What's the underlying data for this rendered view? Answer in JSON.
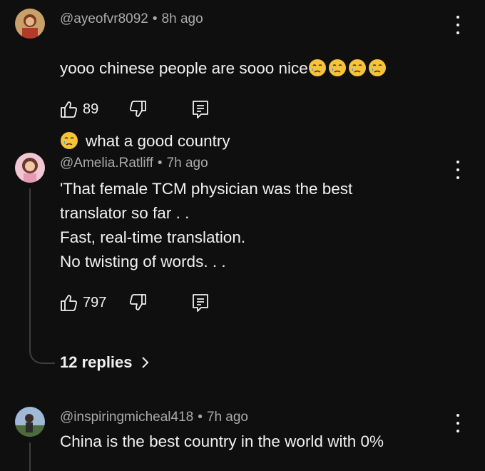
{
  "colors": {
    "background": "#0f0f0f",
    "text": "#f1f1f1",
    "meta": "#aaaaaa",
    "thread_line": "#3f3f3f",
    "emoji": "#f7c33a"
  },
  "comments": [
    {
      "author": "@ayeofvr8092",
      "time": "8h ago",
      "text_line1": "yooo chinese people are sooo nice",
      "text_line2": "what a good country",
      "emoji": "crying-face-with-tear",
      "likes": "89",
      "icons": [
        "thumbs-up-icon",
        "thumbs-down-icon",
        "reply-icon",
        "more-vert-icon"
      ]
    },
    {
      "author": "@Amelia.Ratliff",
      "time": "7h ago",
      "text": "'That female TCM physician was the best\ntranslator so far . .\nFast, real-time translation.\nNo twisting of words. . .",
      "likes": "797",
      "replies": "12 replies"
    },
    {
      "author": "@inspiringmicheal418",
      "time": "7h ago",
      "text": "China is the best country in the world with 0%"
    }
  ]
}
